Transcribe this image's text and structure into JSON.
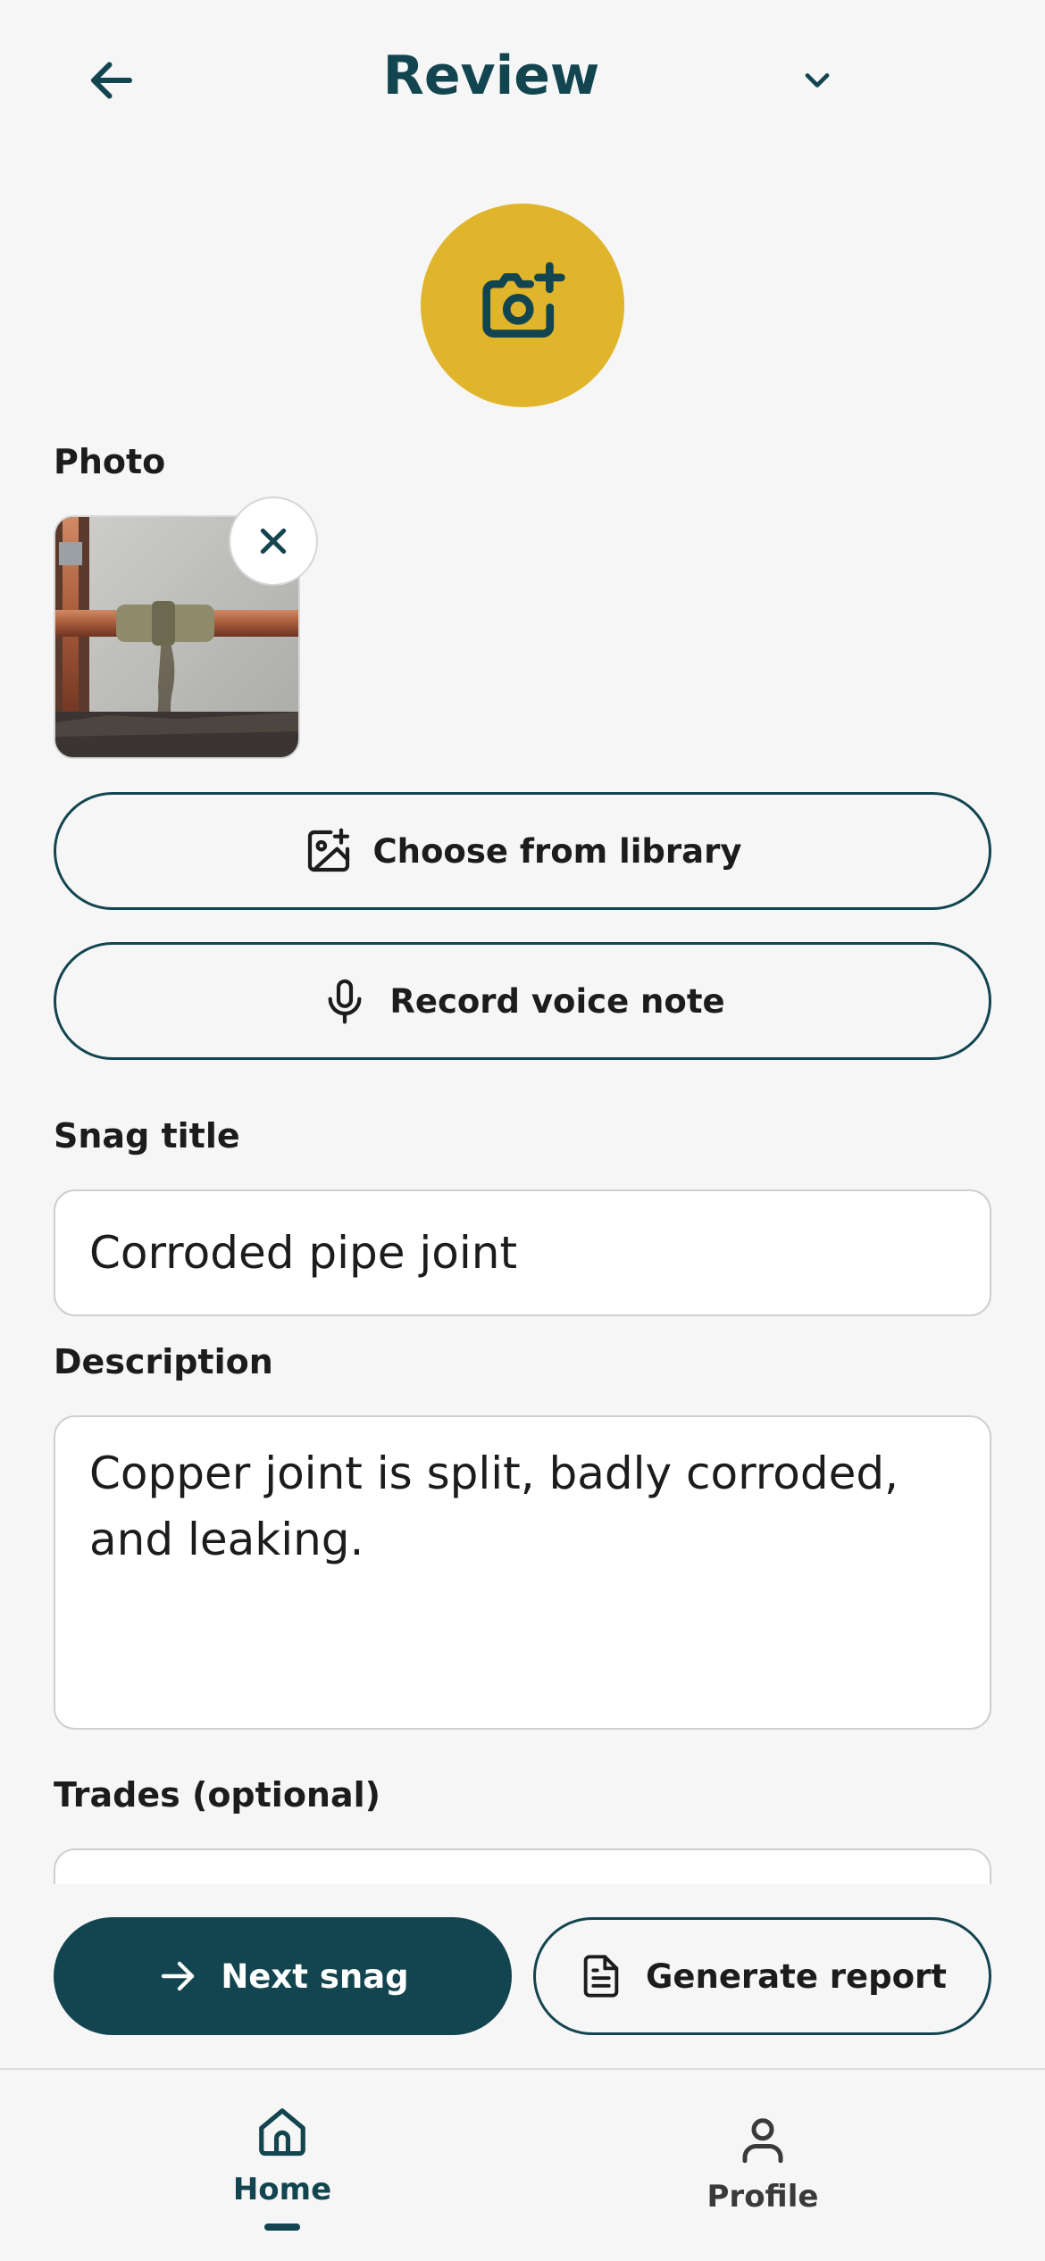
{
  "header": {
    "title": "Review"
  },
  "photo_section": {
    "label": "Photo"
  },
  "actions": {
    "choose_library": "Choose from library",
    "record_voice": "Record voice note"
  },
  "snag_title": {
    "label": "Snag title",
    "value": "Corroded pipe joint"
  },
  "description": {
    "label": "Description",
    "value": "Copper joint is split, badly corroded, and leaking."
  },
  "trades": {
    "label": "Trades (optional)"
  },
  "footer_buttons": {
    "next_snag": "Next snag",
    "generate_report": "Generate report"
  },
  "tabbar": {
    "items": [
      {
        "label": "Home",
        "icon": "home-icon",
        "active": true
      },
      {
        "label": "Profile",
        "icon": "person-icon",
        "active": false
      }
    ]
  },
  "colors": {
    "brand": "#12454f",
    "accent": "#e0b52c",
    "background": "#f6f6f6"
  }
}
